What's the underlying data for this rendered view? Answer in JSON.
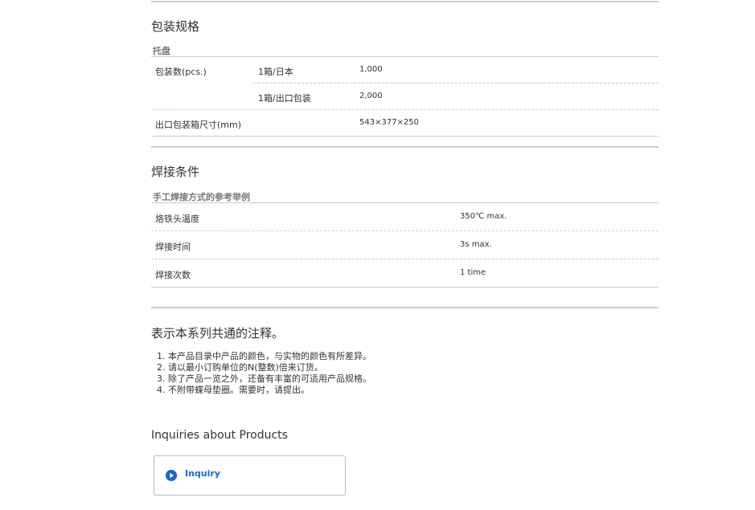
{
  "packaging": {
    "title": "包装规格",
    "subtitle": "托盘",
    "rows": [
      {
        "label": "包装数(pcs.)",
        "sub": "1箱/日本",
        "value": "1,000"
      },
      {
        "label": "",
        "sub": "1箱/出口包装",
        "value": "2,000"
      },
      {
        "label": "出口包装箱尺寸(mm)",
        "sub": "",
        "value": "543×377×250"
      }
    ]
  },
  "soldering": {
    "title": "焊接条件",
    "subtitle": "手工焊接方式的参考举例",
    "rows": [
      {
        "label": "烙铁头温度",
        "value": "350℃ max."
      },
      {
        "label": "焊接时间",
        "value": "3s max."
      },
      {
        "label": "焊接次数",
        "value": "1 time"
      }
    ]
  },
  "notes": {
    "title": "表示本系列共通的注释。",
    "items": [
      "1. 本产品目录中产品的颜色，与实物的颜色有所差异。",
      "2. 请以最小订购单位的N(整数)倍来订货。",
      "3. 除了产品一览之外，还备有丰富的可适用产品规格。",
      "4. 不附带蝶母垫圈。需要时，请提出。"
    ]
  },
  "inquiries": {
    "title": "Inquiries about Products",
    "button_label": "Inquiry",
    "icon": "play-circle-icon",
    "accent": "#1a66c8"
  }
}
